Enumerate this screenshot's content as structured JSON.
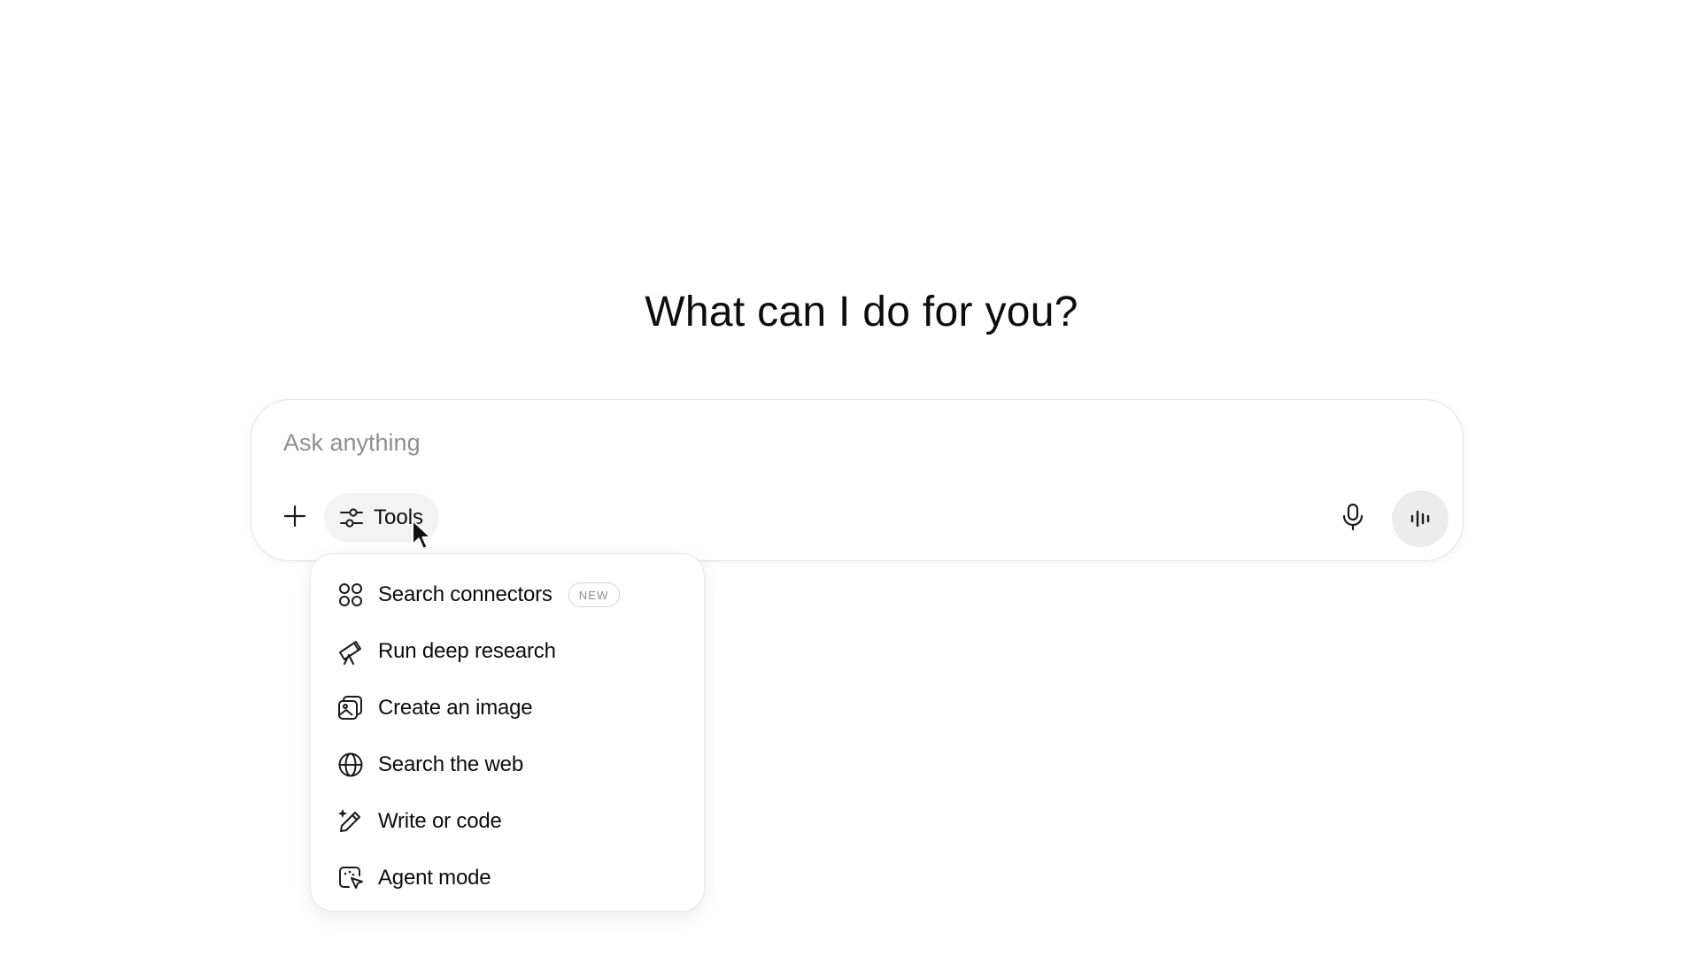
{
  "headline": "What can I do for you?",
  "composer": {
    "placeholder": "Ask anything",
    "value": "",
    "add_icon": "plus-icon",
    "tools": {
      "label": "Tools",
      "icon": "sliders-icon"
    },
    "mic_icon": "microphone-icon",
    "voice_icon": "voice-waveform-icon"
  },
  "tools_menu": {
    "items": [
      {
        "label": "Search connectors",
        "icon": "connectors-icon",
        "badge": "NEW"
      },
      {
        "label": "Run deep research",
        "icon": "telescope-icon"
      },
      {
        "label": "Create an image",
        "icon": "image-icon"
      },
      {
        "label": "Search the web",
        "icon": "globe-icon"
      },
      {
        "label": "Write or code",
        "icon": "pencil-sparkle-icon"
      },
      {
        "label": "Agent mode",
        "icon": "agent-cursor-icon"
      }
    ]
  }
}
